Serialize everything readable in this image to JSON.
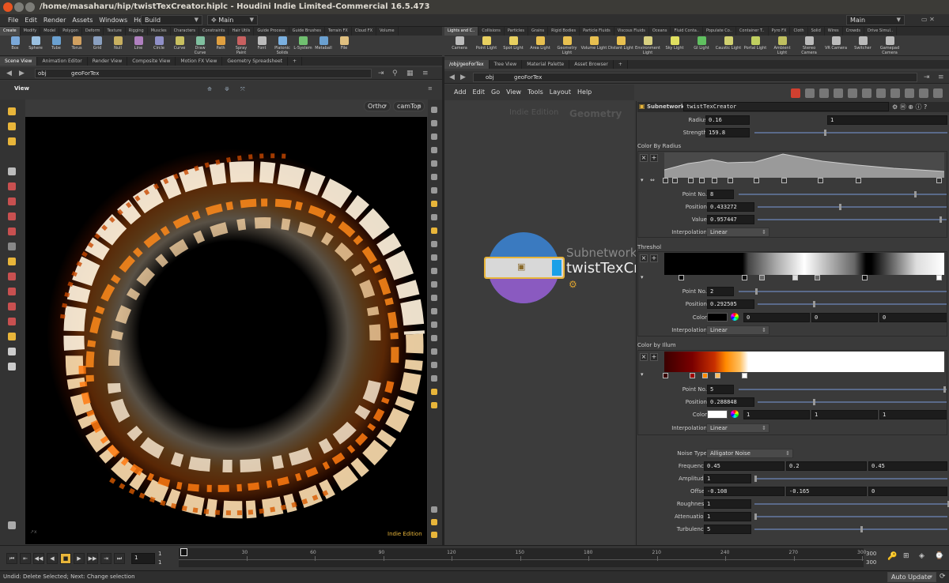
{
  "window": {
    "title": "/home/masaharu/hip/twistTexCreator.hiplc - Houdini Indie Limited-Commercial 16.5.473"
  },
  "menu": [
    "File",
    "Edit",
    "Render",
    "Assets",
    "Windows",
    "Help"
  ],
  "desktop_left": "Build",
  "desktop_mid": "Main",
  "desktop_right": "Main",
  "shelf_tabs_left": [
    "Create",
    "Modify",
    "Model",
    "Polygon",
    "Deform",
    "Texture",
    "Rigging",
    "Muscles",
    "Characters",
    "Constraints",
    "Hair Utils",
    "Guide Process",
    "Guide Brushes",
    "Terrain FX",
    "Cloud FX",
    "Volume"
  ],
  "shelf_tools_left": [
    "Box",
    "Sphere",
    "Tube",
    "Torus",
    "Grid",
    "Null",
    "Line",
    "Circle",
    "Curve",
    "Draw Curve",
    "Path",
    "Spray Paint",
    "Font",
    "Platonic Solids",
    "L-System",
    "Metaball",
    "File"
  ],
  "shelf_tabs_right": [
    "Lights and C..",
    "Collisions",
    "Particles",
    "Grains",
    "Rigid Bodies",
    "Particle Fluids",
    "Viscous Fluids",
    "Oceans",
    "Fluid Conta..",
    "Populate Co..",
    "Container T..",
    "Pyro FX",
    "Cloth",
    "Solid",
    "Wires",
    "Crowds",
    "Drive Simul.."
  ],
  "shelf_tools_right": [
    "Camera",
    "Point Light",
    "Spot Light",
    "Area Light",
    "Geometry Light",
    "Volume Light",
    "Distant Light",
    "Environment Light",
    "Sky Light",
    "GI Light",
    "Caustic Light",
    "Portal Light",
    "Ambient Light",
    "Stereo Camera",
    "VR Camera",
    "Switcher",
    "Gamepad Camera"
  ],
  "left_pane_tabs": [
    "Scene View",
    "Animation Editor",
    "Render View",
    "Composite View",
    "Motion FX View",
    "Geometry Spreadsheet"
  ],
  "right_pane_tabs": [
    "/obj/geoForTex",
    "Tree View",
    "Material Palette",
    "Asset Browser"
  ],
  "left_path": {
    "root": "obj",
    "node": "geoForTex"
  },
  "right_path": {
    "root": "obj",
    "node": "geoForTex"
  },
  "viewport": {
    "title": "View",
    "ortho": "Ortho",
    "cam": "camTop",
    "watermark": "Indie Edition"
  },
  "network": {
    "menus": [
      "Add",
      "Edit",
      "Go",
      "View",
      "Tools",
      "Layout",
      "Help"
    ],
    "watermark_a": "Indie Edition",
    "watermark_b": "Geometry",
    "node_type": "Subnetwork",
    "node_name": "twistTexCreator"
  },
  "params": {
    "header_type": "Subnetwork",
    "header_name": "twistTexCreator",
    "radius": {
      "label": "Radius",
      "v1": "0.16",
      "v2": "1"
    },
    "strength": {
      "label": "Strength",
      "value": "159.8",
      "level": 0.36
    },
    "ramp1": {
      "title": "Color By Radius",
      "point_label": "Point No.",
      "point": "8",
      "point_level": 0.84,
      "pos_label": "Position",
      "position": "0.433272",
      "pos_level": 0.43,
      "val_label": "Value",
      "value": "0.957447",
      "val_level": 0.96,
      "interp_label": "Interpolation",
      "interp": "Linear"
    },
    "ramp2": {
      "title": "Threshol",
      "point_label": "Point No.",
      "point": "2",
      "point_level": 0.08,
      "pos_label": "Position",
      "position": "0.292505",
      "pos_level": 0.29,
      "color_label": "Color",
      "c1": "0",
      "c2": "0",
      "c3": "0",
      "interp_label": "Interpolation",
      "interp": "Linear"
    },
    "ramp3": {
      "title": "Color by Illum",
      "point_label": "Point No.",
      "point": "5",
      "pos_label": "Position",
      "position": "0.288848",
      "pos_level": 0.29,
      "color_label": "Color",
      "c1": "1",
      "c2": "1",
      "c3": "1",
      "interp_label": "Interpolation",
      "interp": "Linear"
    },
    "noise_type": {
      "label": "Noise Type",
      "value": "Alligator Noise"
    },
    "frequency": {
      "label": "Frequency",
      "v1": "0.45",
      "v2": "0.2",
      "v3": "0.45"
    },
    "amplitude": {
      "label": "Amplitude",
      "value": "1"
    },
    "offset": {
      "label": "Offset",
      "v1": "-0.108",
      "v2": "-0.165",
      "v3": "0"
    },
    "roughness": {
      "label": "Roughness",
      "value": "1"
    },
    "attenuation": {
      "label": "Attenuation",
      "value": "1"
    },
    "turbulence": {
      "label": "Turbulence",
      "value": "5",
      "level": 0.55
    }
  },
  "timeline": {
    "ticks": [
      "1",
      "30",
      "60",
      "90",
      "120",
      "150",
      "180",
      "210",
      "240",
      "270",
      "300"
    ],
    "frame": "1",
    "start": "1",
    "start2": "1",
    "end": "300",
    "end2": "300",
    "auto_update": "Auto Update"
  },
  "status": "Undid: Delete Selected; Next: Change selection",
  "colors": {
    "accent": "#e8b53a",
    "fire": "#ff8a1a",
    "panel": "#3a3a3a",
    "field": "#1c1c1c"
  }
}
